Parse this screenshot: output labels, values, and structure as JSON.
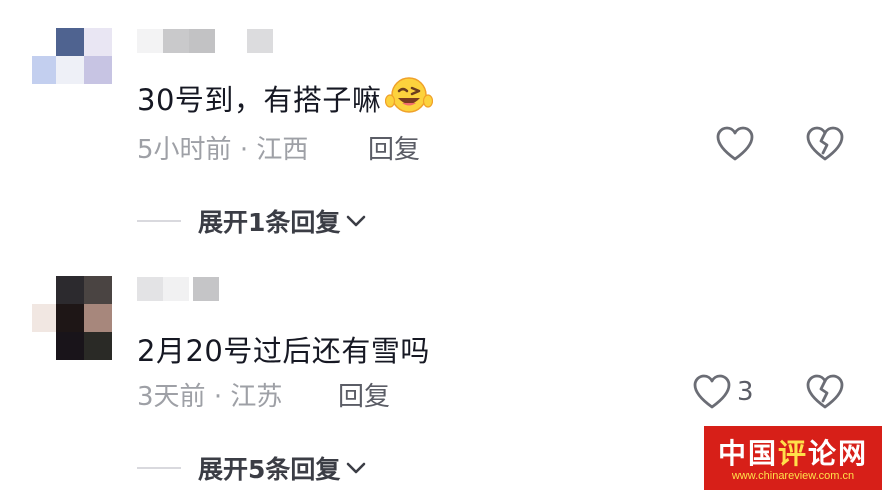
{
  "comments": [
    {
      "text": "30号到，有搭子嘛",
      "time": "5小时前",
      "separator": "·",
      "location": "江西",
      "reply_label": "回复",
      "like_count": "",
      "expand_label": "展开1条回复"
    },
    {
      "text": "2月20号过后还有雪吗",
      "time": "3天前",
      "separator": "·",
      "location": "江苏",
      "reply_label": "回复",
      "like_count": "3",
      "expand_label": "展开5条回复"
    }
  ],
  "watermark": {
    "title_part1": "中国",
    "title_part2": "评",
    "title_part3": "论网",
    "url": "www.chinareview.com.cn"
  },
  "colors": {
    "primary_text": "#161823",
    "secondary_text": "#9ea0a6",
    "action_text": "#5b5d66",
    "watermark_bg": "#d71f18",
    "watermark_accent": "#ffe04a"
  },
  "icons": {
    "like": "heart-outline-icon",
    "dislike": "broken-heart-icon",
    "expand": "chevron-down-icon",
    "emoji": "laughing-emoji-icon"
  }
}
